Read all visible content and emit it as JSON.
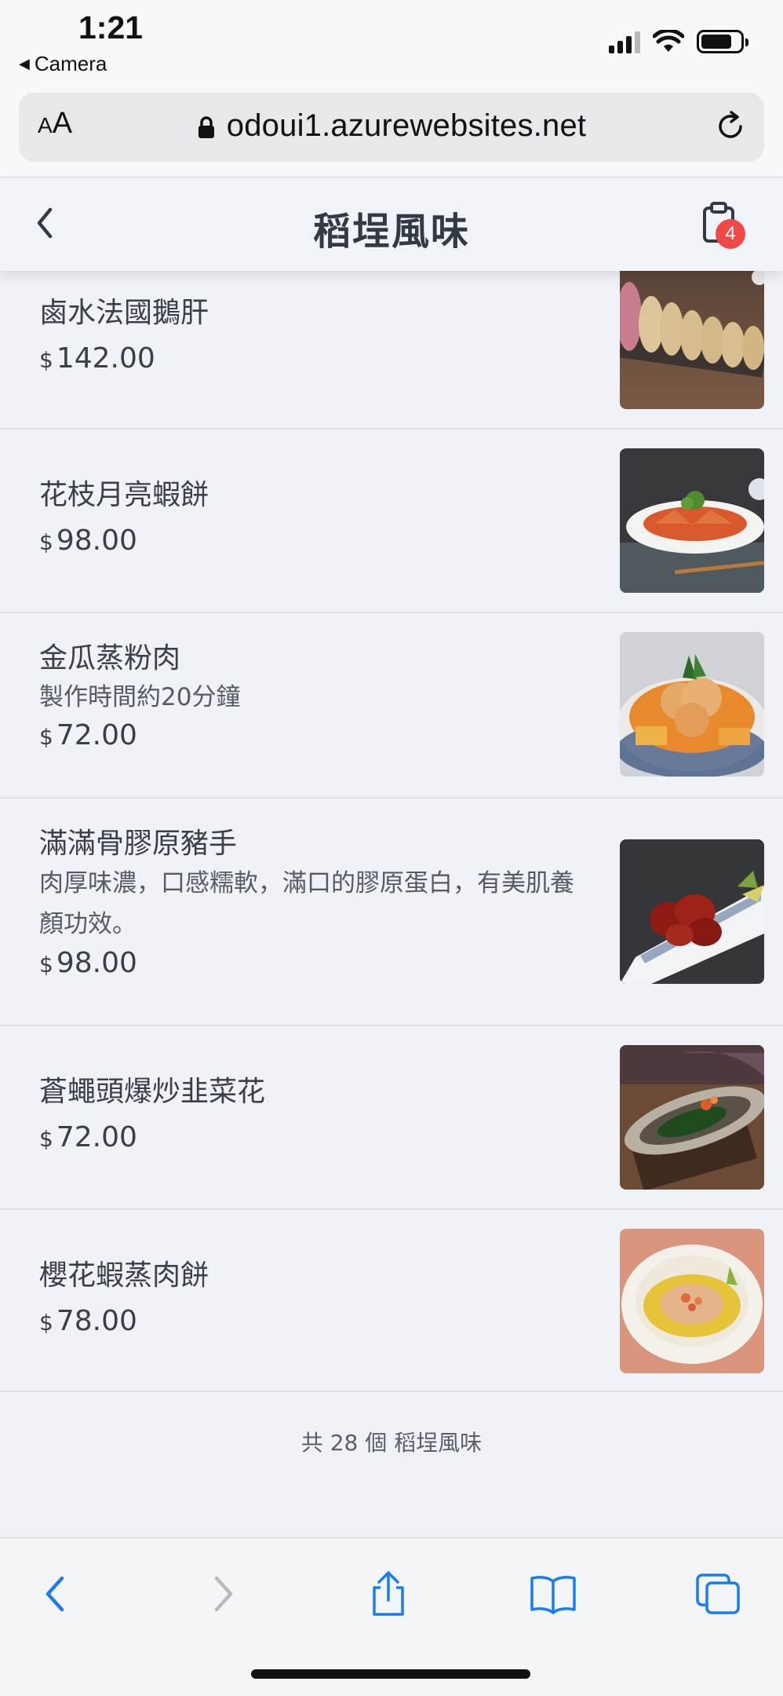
{
  "status_bar": {
    "time": "1:21",
    "back_app": "Camera"
  },
  "browser": {
    "aa_small": "A",
    "aa_large": "A",
    "url": "odoui1.azurewebsites.net"
  },
  "header": {
    "title": "稻埕風味",
    "cart_count": "4"
  },
  "items": [
    {
      "name": "鹵水法國鵝肝",
      "desc": "",
      "currency": "$",
      "price": "142.00",
      "image": "foie-gras-photo"
    },
    {
      "name": "花枝月亮蝦餅",
      "desc": "",
      "currency": "$",
      "price": "98.00",
      "image": "shrimp-cake-photo"
    },
    {
      "name": "金瓜蒸粉肉",
      "desc": "製作時間約20分鐘",
      "currency": "$",
      "price": "72.00",
      "image": "pumpkin-pork-photo"
    },
    {
      "name": "滿滿骨膠原豬手",
      "desc": "肉厚味濃，口感糯軟，滿口的膠原蛋白，有美肌養顏功效。",
      "currency": "$",
      "price": "98.00",
      "image": "pork-knuckle-photo"
    },
    {
      "name": "蒼蠅頭爆炒韭菜花",
      "desc": "",
      "currency": "$",
      "price": "72.00",
      "image": "chive-flower-photo"
    },
    {
      "name": "櫻花蝦蒸肉餅",
      "desc": "",
      "currency": "$",
      "price": "78.00",
      "image": "sakura-shrimp-patty-photo"
    }
  ],
  "footer": {
    "summary": "共 28 個 稻埕風味"
  },
  "toolbar": {
    "icons": [
      "back-icon",
      "forward-icon",
      "share-icon",
      "bookmarks-icon",
      "tabs-icon"
    ]
  },
  "colors": {
    "accent": "#1a7cf0",
    "badge": "#f04848",
    "background": "#eff2f6"
  }
}
